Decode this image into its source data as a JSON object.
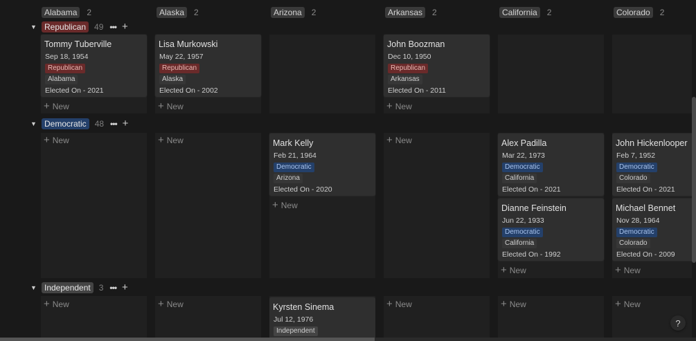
{
  "columns": [
    {
      "label": "Alabama",
      "count": "2"
    },
    {
      "label": "Alaska",
      "count": "2"
    },
    {
      "label": "Arizona",
      "count": "2"
    },
    {
      "label": "Arkansas",
      "count": "2"
    },
    {
      "label": "California",
      "count": "2"
    },
    {
      "label": "Colorado",
      "count": "2"
    }
  ],
  "groups": {
    "republican": {
      "label": "Republican",
      "count": "49",
      "color": "#6a2a2a"
    },
    "democratic": {
      "label": "Democratic",
      "count": "48",
      "color": "#24406a"
    },
    "independent": {
      "label": "Independent",
      "count": "3",
      "color": "#444444"
    }
  },
  "icons": {
    "collapse": "▼",
    "more": "•••",
    "add": "+",
    "help": "?"
  },
  "new_label": "New",
  "cards": {
    "tuberville": {
      "name": "Tommy Tuberville",
      "dob": "Sep 18, 1954",
      "party": "Republican",
      "state": "Alabama",
      "elected": "Elected On - 2021"
    },
    "murkowski": {
      "name": "Lisa Murkowski",
      "dob": "May 22, 1957",
      "party": "Republican",
      "state": "Alaska",
      "elected": "Elected On - 2002"
    },
    "boozman": {
      "name": "John Boozman",
      "dob": "Dec 10, 1950",
      "party": "Republican",
      "state": "Arkansas",
      "elected": "Elected On - 2011"
    },
    "kelly": {
      "name": "Mark Kelly",
      "dob": "Feb 21, 1964",
      "party": "Democratic",
      "state": "Arizona",
      "elected": "Elected On - 2020"
    },
    "padilla": {
      "name": "Alex Padilla",
      "dob": "Mar 22, 1973",
      "party": "Democratic",
      "state": "California",
      "elected": "Elected On - 2021"
    },
    "feinstein": {
      "name": "Dianne Feinstein",
      "dob": "Jun 22, 1933",
      "party": "Democratic",
      "state": "California",
      "elected": "Elected On - 1992"
    },
    "hickenlooper": {
      "name": "John Hickenlooper",
      "dob": "Feb 7, 1952",
      "party": "Democratic",
      "state": "Colorado",
      "elected": "Elected On - 2021"
    },
    "bennet": {
      "name": "Michael Bennet",
      "dob": "Nov 28, 1964",
      "party": "Democratic",
      "state": "Colorado",
      "elected": "Elected On - 2009"
    },
    "sinema": {
      "name": "Kyrsten Sinema",
      "dob": "Jul 12, 1976",
      "party": "Independent"
    }
  }
}
